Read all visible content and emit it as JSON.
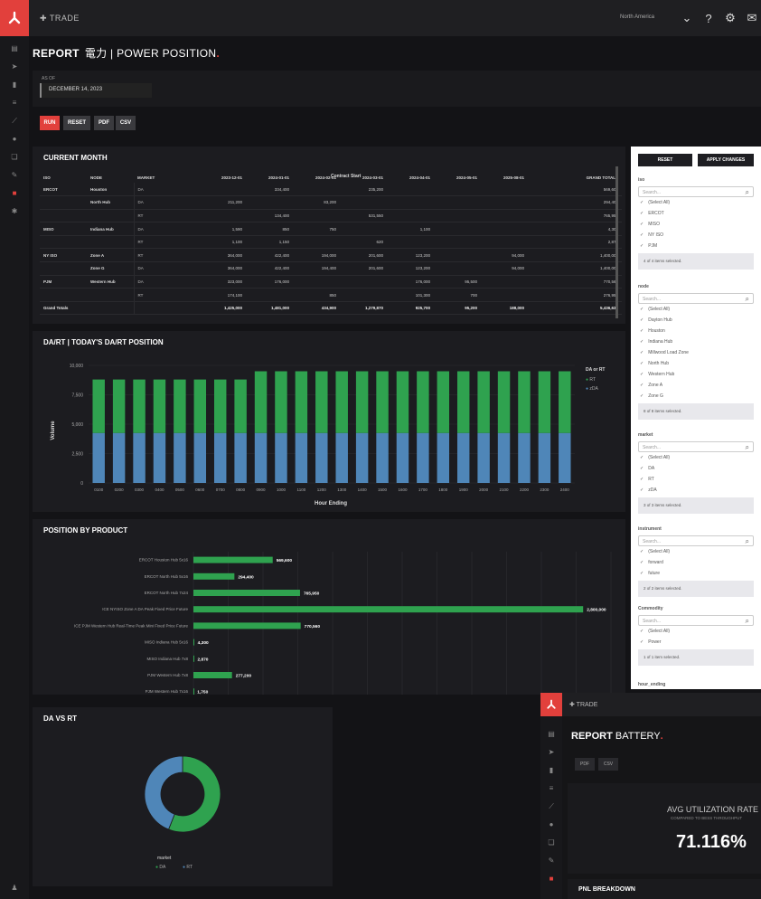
{
  "topbar": {
    "app": "✚ TRADE",
    "region": "North America"
  },
  "report": {
    "prefix": "REPORT",
    "name": "電力 | POWER POSITION",
    "dot": "."
  },
  "asof": {
    "label": "AS OF",
    "value": "DECEMBER 14, 2023"
  },
  "buttons": {
    "run": "RUN",
    "reset": "RESET",
    "pdf": "PDF",
    "csv": "CSV"
  },
  "current_month": {
    "title": "CURRENT MONTH",
    "contract_start": "Contract Start",
    "headers": [
      "ISO",
      "NODE",
      "MARKET",
      "2023-12-01",
      "2024-01-01",
      "2024-02-01",
      "2024-03-01",
      "2024-04-01",
      "2024-05-01",
      "2025-08-01",
      "GRAND TOTALS"
    ],
    "rows": [
      [
        "ERCOT",
        "Houston",
        "DA",
        "",
        "334,400",
        "",
        "235,200",
        "",
        "",
        "",
        "569,600"
      ],
      [
        "",
        "North Hub",
        "DA",
        "211,200",
        "",
        "83,200",
        "",
        "",
        "",
        "",
        "294,400"
      ],
      [
        "",
        "",
        "RT",
        "",
        "134,400",
        "",
        "531,550",
        "",
        "",
        "",
        "765,950"
      ],
      [
        "MISO",
        "Indiana Hub",
        "DA",
        "1,590",
        "850",
        "750",
        "",
        "1,100",
        "",
        "",
        "4,300"
      ],
      [
        "",
        "",
        "RT",
        "1,100",
        "1,150",
        "",
        "620",
        "",
        "",
        "",
        "2,870"
      ],
      [
        "NY ISO",
        "Zone A",
        "RT",
        "364,000",
        "422,400",
        "194,000",
        "201,600",
        "123,200",
        "",
        "94,000",
        "1,400,000"
      ],
      [
        "",
        "Zone G",
        "DA",
        "364,000",
        "422,400",
        "194,400",
        "201,600",
        "123,200",
        "",
        "94,000",
        "1,400,000"
      ],
      [
        "PJM",
        "Western Hub",
        "DA",
        "323,000",
        "176,000",
        "",
        "",
        "176,000",
        "95,500",
        "",
        "770,560"
      ],
      [
        "",
        "",
        "RT",
        "174,100",
        "",
        "850",
        "",
        "101,300",
        "700",
        "",
        "276,950"
      ],
      [
        "Grand Totals",
        "",
        "",
        "1,425,000",
        "1,481,000",
        "434,900",
        "1,279,870",
        "925,700",
        "95,200",
        "188,000",
        "5,436,630"
      ]
    ]
  },
  "dart": {
    "title": "DA/RT | TODAY'S DA/RT POSITION",
    "legend_title": "DA or RT",
    "legend": [
      "RT",
      "zDA"
    ]
  },
  "product": {
    "title": "POSITION BY PRODUCT"
  },
  "davsrt": {
    "title": "DA VS RT",
    "legend_title": "market",
    "legend": [
      "DA",
      "RT"
    ]
  },
  "filters": {
    "reset": "RESET",
    "apply": "APPLY CHANGES",
    "sections": [
      {
        "name": "iso",
        "search": "Search...",
        "items": [
          "(Select All)",
          "ERCOT",
          "MISO",
          "NY ISO",
          "PJM"
        ],
        "count": "4 of 4 items selected."
      },
      {
        "name": "node",
        "search": "Search...",
        "items": [
          "(Select All)",
          "Dayton Hub",
          "Houston",
          "Indiana Hub",
          "Millwood Load Zone",
          "North Hub",
          "Western Hub",
          "Zone A",
          "Zone G"
        ],
        "count": "8 of 8 items selected."
      },
      {
        "name": "market",
        "search": "Search...",
        "items": [
          "(Select All)",
          "DA",
          "RT",
          "zDA"
        ],
        "count": "3 of 3 items selected."
      },
      {
        "name": "instrument",
        "search": "Search...",
        "items": [
          "(Select All)",
          "forward",
          "future"
        ],
        "count": "2 of 2 items selected."
      },
      {
        "name": "Commodity",
        "search": "Search...",
        "items": [
          "(Select All)",
          "Power"
        ],
        "count": "1 of 1 item selected."
      }
    ],
    "last": "hour_ending"
  },
  "battery": {
    "app": "✚ TRADE",
    "prefix": "REPORT",
    "name": "BATTERY",
    "dot": ".",
    "pdf": "PDF",
    "csv": "CSV",
    "metric_title": "AVG UTILIZATION RATE",
    "metric_sub": "COMPARED TO BESS THROUGHPUT",
    "metric_value": "71.116%",
    "pnl": "PNL BREAKDOWN"
  },
  "colors": {
    "accent": "#e2403c",
    "green": "#2fa24f",
    "blue": "#4f86b8"
  },
  "chart_data": [
    {
      "type": "bar",
      "stacked": true,
      "title": "DA/RT | TODAY'S DA/RT POSITION",
      "xlabel": "Hour Ending",
      "ylabel": "Volume",
      "ylim": [
        0,
        10000
      ],
      "yticks": [
        "0",
        "2,500",
        "5,000",
        "7,500",
        "10,000"
      ],
      "categories": [
        "0100",
        "0200",
        "0300",
        "0400",
        "0500",
        "0600",
        "0700",
        "0800",
        "0900",
        "1000",
        "1100",
        "1200",
        "1300",
        "1400",
        "1500",
        "1600",
        "1700",
        "1800",
        "1900",
        "2000",
        "2100",
        "2200",
        "2300",
        "2400"
      ],
      "series": [
        {
          "name": "zDA",
          "values": [
            4250,
            4250,
            4250,
            4250,
            4250,
            4250,
            4250,
            4250,
            4250,
            4250,
            4250,
            4250,
            4250,
            4250,
            4250,
            4250,
            4250,
            4250,
            4250,
            4250,
            4250,
            4250,
            4250,
            4250
          ]
        },
        {
          "name": "RT",
          "values": [
            4550,
            4550,
            4550,
            4550,
            4550,
            4550,
            4550,
            4550,
            5250,
            5250,
            5250,
            5250,
            5250,
            5250,
            5250,
            5250,
            5250,
            5250,
            5250,
            5250,
            5250,
            5250,
            5250,
            5250
          ]
        }
      ],
      "legend": "right"
    },
    {
      "type": "bar",
      "orientation": "horizontal",
      "title": "POSITION BY PRODUCT",
      "categories": [
        "ERCOT Houston Hub 5x16",
        "ERCOT North Hub 5x16",
        "ERCOT North Hub 7x24",
        "ICE NYISO Zone A DA Peak Fixed Price Future",
        "ICE PJM Western Hub Real-Time Peak Mini Fixed Price Future",
        "MISO Indiana Hub 5x16",
        "MISO Indiana Hub 7x8",
        "PJM Western Hub 7x8",
        "PJM Western Hub 7x16"
      ],
      "values": [
        569600,
        294400,
        765950,
        2800000,
        770560,
        4300,
        2870,
        277200,
        1750
      ],
      "value_labels": [
        "569,600",
        "294,400",
        "765,950",
        "2,800,000",
        "770,560",
        "4,300",
        "2,870",
        "277,200",
        "1,750"
      ],
      "xticks": [
        "0",
        "250,000",
        "500,000",
        "750,000",
        "1,000,000",
        "1,250,000",
        "1,500,000",
        "1,750,000",
        "2,000,000",
        "2,250,000",
        "2,500,000",
        "2,750,000",
        "3,000,000"
      ],
      "xlim": [
        0,
        3000000
      ]
    },
    {
      "type": "pie",
      "donut": true,
      "title": "DA VS RT",
      "categories": [
        "DA",
        "RT"
      ],
      "values": [
        56,
        44
      ]
    }
  ]
}
